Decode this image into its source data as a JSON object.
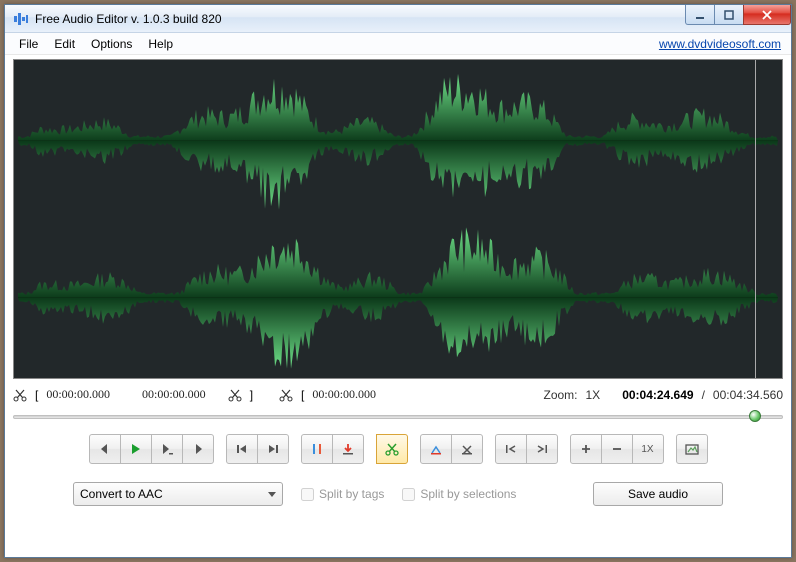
{
  "titlebar": {
    "title": "Free Audio Editor v. 1.0.3 build 820"
  },
  "menu": {
    "file": "File",
    "edit": "Edit",
    "options": "Options",
    "help": "Help",
    "link": "www.dvdvideosoft.com"
  },
  "info": {
    "selStart": "00:00:00.000",
    "selEnd": "00:00:00.000",
    "cutTime": "00:00:00.000"
  },
  "zoom": {
    "label": "Zoom:",
    "level": "1X",
    "current": "00:04:24.649",
    "sep": "/",
    "total": "00:04:34.560"
  },
  "toolbar": {
    "zoom1x": "1X"
  },
  "bottom": {
    "convert": "Convert to AAC",
    "splitTags": "Split by tags",
    "splitSel": "Split by selections",
    "save": "Save audio"
  }
}
